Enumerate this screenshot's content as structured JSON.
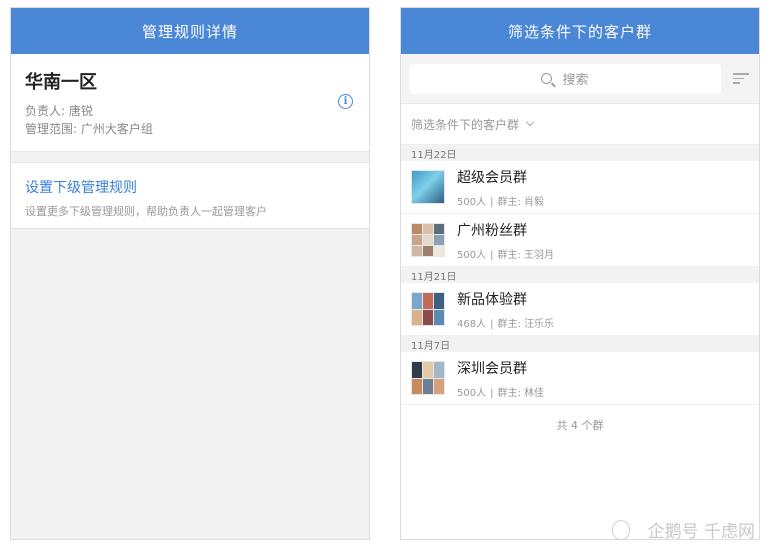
{
  "left": {
    "title": "管理规则详情",
    "area_name": "华南一区",
    "owner_line": "负责人: 唐锐",
    "scope_line": "管理范围: 广州大客户组",
    "rule_title": "设置下级管理规则",
    "rule_desc": "设置更多下级管理规则，帮助负责人一起管理客户"
  },
  "right": {
    "title": "筛选条件下的客户群",
    "search_placeholder": "搜索",
    "filter_label": "筛选条件下的客户群",
    "sections": [
      {
        "date": "11月22日",
        "groups": [
          {
            "name": "超级会员群",
            "count": "500人",
            "owner": "群主: 肖毅"
          },
          {
            "name": "广州粉丝群",
            "count": "500人",
            "owner": "群主: 王羽月"
          }
        ]
      },
      {
        "date": "11月21日",
        "groups": [
          {
            "name": "新品体验群",
            "count": "468人",
            "owner": "群主: 汪乐乐"
          }
        ]
      },
      {
        "date": "11月7日",
        "groups": [
          {
            "name": "深圳会员群",
            "count": "500人",
            "owner": "群主: 林佳"
          }
        ]
      }
    ],
    "total_text": "共 4 个群"
  },
  "watermark": "企鹅号 千虑网",
  "colors": {
    "accent": "#4a87d6",
    "link": "#3a7fd5"
  }
}
